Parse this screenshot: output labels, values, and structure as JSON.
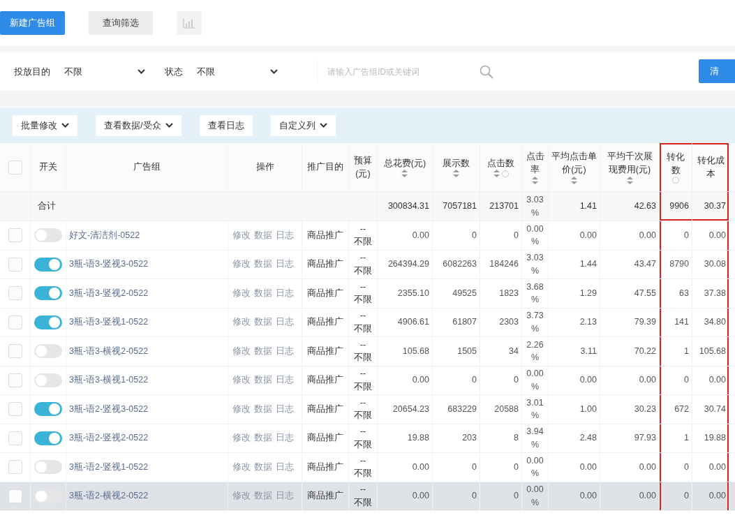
{
  "top_buttons": [
    {
      "label": "新建广告组",
      "kind": "primary"
    },
    {
      "label": "查询筛选",
      "kind": "secondary"
    },
    {
      "kind": "chart-icon"
    }
  ],
  "filters": {
    "items": [
      {
        "label": "投放目的",
        "value": "不限"
      },
      {
        "label": "状态",
        "value": "不限"
      }
    ],
    "search": {
      "placeholder": "请输入广告组ID或关键词"
    },
    "action_button": "清"
  },
  "toolbar": [
    {
      "label": "批量修改",
      "dropdown": true
    },
    {
      "label": "查看数据/受众",
      "dropdown": true
    },
    {
      "label": "查看日志",
      "dropdown": false
    },
    {
      "label": "自定义列",
      "dropdown": true
    }
  ],
  "table": {
    "select_all_checked": false,
    "columns": [
      {
        "label": "开关",
        "sortable": false,
        "help": false,
        "highlighted": false
      },
      {
        "label": "广告组",
        "sortable": false,
        "help": false,
        "highlighted": false
      },
      {
        "label": "操作",
        "sortable": false,
        "help": false,
        "highlighted": false
      },
      {
        "label": "推广目的",
        "sortable": false,
        "help": false,
        "highlighted": false
      },
      {
        "label": "预算(元)",
        "sortable": false,
        "help": false,
        "highlighted": false
      },
      {
        "label": "总花费(元)",
        "sortable": true,
        "help": false,
        "highlighted": false
      },
      {
        "label": "展示数",
        "sortable": true,
        "help": false,
        "highlighted": false
      },
      {
        "label": "点击数",
        "sortable": true,
        "help": true,
        "highlighted": false
      },
      {
        "label": "点击率",
        "sortable": true,
        "help": false,
        "highlighted": false
      },
      {
        "label": "平均点击单价(元)",
        "sortable": true,
        "help": false,
        "highlighted": false
      },
      {
        "label": "平均千次展现费用(元)",
        "sortable": true,
        "help": false,
        "highlighted": false
      },
      {
        "label": "转化数",
        "sortable": false,
        "help": true,
        "highlighted": true
      },
      {
        "label": "转化成本",
        "sortable": false,
        "help": false,
        "highlighted": true
      }
    ],
    "total": {
      "label": "合计",
      "spend": "300834.31",
      "impressions": "7057181",
      "clicks": "213701",
      "ctr": "3.03 %",
      "cpc": "1.41",
      "cpm": "42.63",
      "conversions": "9906",
      "cpa": "30.37"
    },
    "rows": [
      {
        "checked": false,
        "on": false,
        "hover": false,
        "name": "好文-清洁剂-0522",
        "ops": [
          "修改",
          "数据",
          "日志"
        ],
        "goal": "商品推广",
        "budget": [
          "--",
          "不限"
        ],
        "spend": "0.00",
        "impressions": "0",
        "clicks": "0",
        "ctr": "0.00 %",
        "cpc": "0.00",
        "cpm": "0.00",
        "conversions": "0",
        "cpa": "0.00"
      },
      {
        "checked": false,
        "on": true,
        "hover": false,
        "name": "3瓶-语3-竖视3-0522",
        "ops": [
          "修改",
          "数据",
          "日志"
        ],
        "goal": "商品推广",
        "budget": [
          "--",
          "不限"
        ],
        "spend": "264394.29",
        "impressions": "6082263",
        "clicks": "184246",
        "ctr": "3.03 %",
        "cpc": "1.44",
        "cpm": "43.47",
        "conversions": "8790",
        "cpa": "30.08"
      },
      {
        "checked": false,
        "on": true,
        "hover": false,
        "name": "3瓶-语3-竖视2-0522",
        "ops": [
          "修改",
          "数据",
          "日志"
        ],
        "goal": "商品推广",
        "budget": [
          "--",
          "不限"
        ],
        "spend": "2355.10",
        "impressions": "49525",
        "clicks": "1823",
        "ctr": "3.68 %",
        "cpc": "1.29",
        "cpm": "47.55",
        "conversions": "63",
        "cpa": "37.38"
      },
      {
        "checked": false,
        "on": true,
        "hover": false,
        "name": "3瓶-语3-竖视1-0522",
        "ops": [
          "修改",
          "数据",
          "日志"
        ],
        "goal": "商品推广",
        "budget": [
          "--",
          "不限"
        ],
        "spend": "4906.61",
        "impressions": "61807",
        "clicks": "2303",
        "ctr": "3.73 %",
        "cpc": "2.13",
        "cpm": "79.39",
        "conversions": "141",
        "cpa": "34.80"
      },
      {
        "checked": false,
        "on": false,
        "hover": false,
        "name": "3瓶-语3-横视2-0522",
        "ops": [
          "修改",
          "数据",
          "日志"
        ],
        "goal": "商品推广",
        "budget": [
          "--",
          "不限"
        ],
        "spend": "105.68",
        "impressions": "1505",
        "clicks": "34",
        "ctr": "2.26 %",
        "cpc": "3.11",
        "cpm": "70.22",
        "conversions": "1",
        "cpa": "105.68"
      },
      {
        "checked": false,
        "on": false,
        "hover": false,
        "name": "3瓶-语3-横视1-0522",
        "ops": [
          "修改",
          "数据",
          "日志"
        ],
        "goal": "商品推广",
        "budget": [
          "--",
          "不限"
        ],
        "spend": "0.00",
        "impressions": "0",
        "clicks": "0",
        "ctr": "0.00 %",
        "cpc": "0.00",
        "cpm": "0.00",
        "conversions": "0",
        "cpa": "0.00"
      },
      {
        "checked": false,
        "on": true,
        "hover": false,
        "name": "3瓶-语2-竖视3-0522",
        "ops": [
          "修改",
          "数据",
          "日志"
        ],
        "goal": "商品推广",
        "budget": [
          "--",
          "不限"
        ],
        "spend": "20654.23",
        "impressions": "683229",
        "clicks": "20588",
        "ctr": "3.01 %",
        "cpc": "1.00",
        "cpm": "30.23",
        "conversions": "672",
        "cpa": "30.74"
      },
      {
        "checked": false,
        "on": true,
        "hover": false,
        "name": "3瓶-语2-竖视2-0522",
        "ops": [
          "修改",
          "数据",
          "日志"
        ],
        "goal": "商品推广",
        "budget": [
          "--",
          "不限"
        ],
        "spend": "19.88",
        "impressions": "203",
        "clicks": "8",
        "ctr": "3.94 %",
        "cpc": "2.48",
        "cpm": "97.93",
        "conversions": "1",
        "cpa": "19.88"
      },
      {
        "checked": false,
        "on": false,
        "hover": false,
        "name": "3瓶-语2-竖视1-0522",
        "ops": [
          "修改",
          "数据",
          "日志"
        ],
        "goal": "商品推广",
        "budget": [
          "--",
          "不限"
        ],
        "spend": "0.00",
        "impressions": "0",
        "clicks": "0",
        "ctr": "0.00 %",
        "cpc": "0.00",
        "cpm": "0.00",
        "conversions": "0",
        "cpa": "0.00"
      },
      {
        "checked": false,
        "on": false,
        "hover": true,
        "name": "3瓶-语2-横视2-0522",
        "ops": [
          "修改",
          "数据",
          "日志"
        ],
        "goal": "商品推广",
        "budget": [
          "--",
          "不限"
        ],
        "spend": "0.00",
        "impressions": "0",
        "clicks": "0",
        "ctr": "0.00 %",
        "cpc": "0.00",
        "cpm": "0.00",
        "conversions": "0",
        "cpa": "0.00"
      }
    ]
  }
}
